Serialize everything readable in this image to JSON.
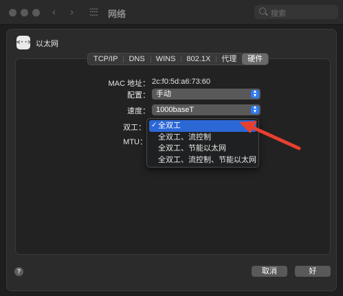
{
  "window": {
    "title": "网络",
    "search_placeholder": "搜索"
  },
  "service": {
    "icon": "ethernet-icon",
    "icon_glyph": "<··>",
    "name": "以太网"
  },
  "tabs": [
    {
      "label": "TCP/IP",
      "active": false
    },
    {
      "label": "DNS",
      "active": false
    },
    {
      "label": "WINS",
      "active": false
    },
    {
      "label": "802.1X",
      "active": false
    },
    {
      "label": "代理",
      "active": false
    },
    {
      "label": "硬件",
      "active": true
    }
  ],
  "hardware": {
    "mac_label": "MAC 地址：",
    "mac_value": "2c:f0:5d:a6:73:60",
    "config_label": "配置：",
    "config_value": "手动",
    "speed_label": "速度：",
    "speed_value": "1000baseT",
    "duplex_label": "双工：",
    "mtu_label": "MTU："
  },
  "duplex_menu": {
    "check": "✓",
    "items": [
      {
        "label": "全双工",
        "selected": true
      },
      {
        "label": "全双工、流控制",
        "selected": false
      },
      {
        "label": "全双工、节能以太网",
        "selected": false
      },
      {
        "label": "全双工、流控制、节能以太网",
        "selected": false
      }
    ]
  },
  "footer": {
    "help": "?",
    "cancel": "取消",
    "ok": "好"
  },
  "colors": {
    "accent": "#2c67d6",
    "annotation_arrow": "#e8402f"
  }
}
